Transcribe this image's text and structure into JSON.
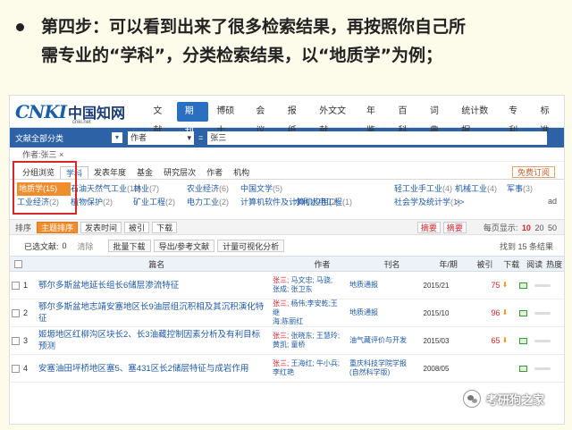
{
  "caption": {
    "line1": "第四步：可以看到出来了很多检索结果，再按照你自己所",
    "line2": "需专业的“学科”，分类检索结果，以“地质学”为例；"
  },
  "header": {
    "logo_text": "CNKI",
    "logo_cn": "中国知网",
    "logo_sub": "cnki.net",
    "nav": [
      "文献",
      "期刊",
      "博硕士",
      "会议",
      "报纸",
      "外文文献",
      "年鉴",
      "百科",
      "词典",
      "统计数据",
      "专利",
      "标准"
    ],
    "active_nav": "期刊"
  },
  "search": {
    "category": "文献全部分类",
    "field": "作者",
    "equals": "=",
    "value": "张三"
  },
  "query_tag": "作者:张三 ×",
  "group_tabs": {
    "items": [
      "分组浏览",
      "学科",
      "发表年度",
      "基金",
      "研究层次",
      "作者",
      "机构"
    ],
    "right_button": "免费订阅"
  },
  "subjects": {
    "row1": [
      {
        "name": "地质学",
        "count": "(15)",
        "selected": true
      },
      {
        "name": "石油天然气工业",
        "count": "(12)"
      },
      {
        "name": "林业",
        "count": "(7)"
      },
      {
        "name": "农业经济",
        "count": "(6)"
      },
      {
        "name": "中国文学",
        "count": "(5)"
      },
      {
        "name": "",
        "count": ""
      },
      {
        "name": "轻工业手工业",
        "count": "(4)"
      },
      {
        "name": "机械工业",
        "count": "(4)"
      },
      {
        "name": "军事",
        "count": "(3)"
      }
    ],
    "row2": [
      {
        "name": "工业经济",
        "count": "(2)"
      },
      {
        "name": "植物保护",
        "count": "(2)"
      },
      {
        "name": "矿业工程",
        "count": "(2)"
      },
      {
        "name": "电力工业",
        "count": "(2)"
      },
      {
        "name": "计算机软件及计算机应用",
        "count": "(2)"
      },
      {
        "name": "水利水电工程",
        "count": "(1)"
      },
      {
        "name": "社会学及统计学",
        "count": "(1)"
      },
      {
        "name": ">>",
        "count": ""
      }
    ],
    "side_label": "ad"
  },
  "sortbar": {
    "label": "排序",
    "options": [
      "主题排序",
      "发表时间",
      "被引",
      "下载"
    ],
    "active": "主题排序",
    "view_list": "摘要",
    "view_abstract": "摘要",
    "per_page_label": "每页显示:",
    "per_page": [
      "10",
      "20",
      "50"
    ],
    "per_page_selected": "10"
  },
  "toolbar": {
    "selected_label": "已选文献:",
    "selected_count": "0",
    "clear": "清除",
    "buttons": [
      "批量下载",
      "导出/参考文献",
      "计量可视化分析"
    ],
    "found": "找到 15 条结果"
  },
  "table": {
    "headers": {
      "title": "篇名",
      "author": "作者",
      "pub": "刊名",
      "date": "年/期",
      "cite": "被引",
      "download": "下载",
      "read": "阅读",
      "heat": "热度"
    },
    "rows": [
      {
        "index": "1",
        "title": "鄂尔多斯盆地延长组长6储层渗流特征",
        "lead": "张三;",
        "authors": " 马文忠; 马骁;\n张成; 张卫东",
        "pub": "地质通报",
        "date": "2015/21",
        "cite": "",
        "download": "75"
      },
      {
        "index": "2",
        "title": "鄂尔多斯盆地志靖安塞地区长9油层组沉积相及其沉积演化特征",
        "lead": "张三;",
        "authors": " 杨伟;李安乾;王继\n海;陈丽红",
        "pub": "地质通报",
        "date": "2015/10",
        "cite": "",
        "download": "96"
      },
      {
        "index": "3",
        "title": "姬塬地区红柳沟区块长2、长3油藏控制因素分析及有利目标预测",
        "lead": "张三;",
        "authors": " 张晓东; 王慧玲;\n黄凯; 童桥",
        "pub": "油气藏评价与开发",
        "date": "2015/03",
        "cite": "",
        "download": "65"
      },
      {
        "index": "4",
        "title": "安塞油田坪桥地区塞5、塞431区长2储层特征与成岩作用",
        "lead": "张三;",
        "authors": " 王海红; 牛小兵;\n李红艳",
        "pub": "重庆科技学院学报\n(自然科学版)",
        "date": "2008/05",
        "cite": "",
        "download": ""
      }
    ]
  },
  "watermark": "考研狗之家"
}
